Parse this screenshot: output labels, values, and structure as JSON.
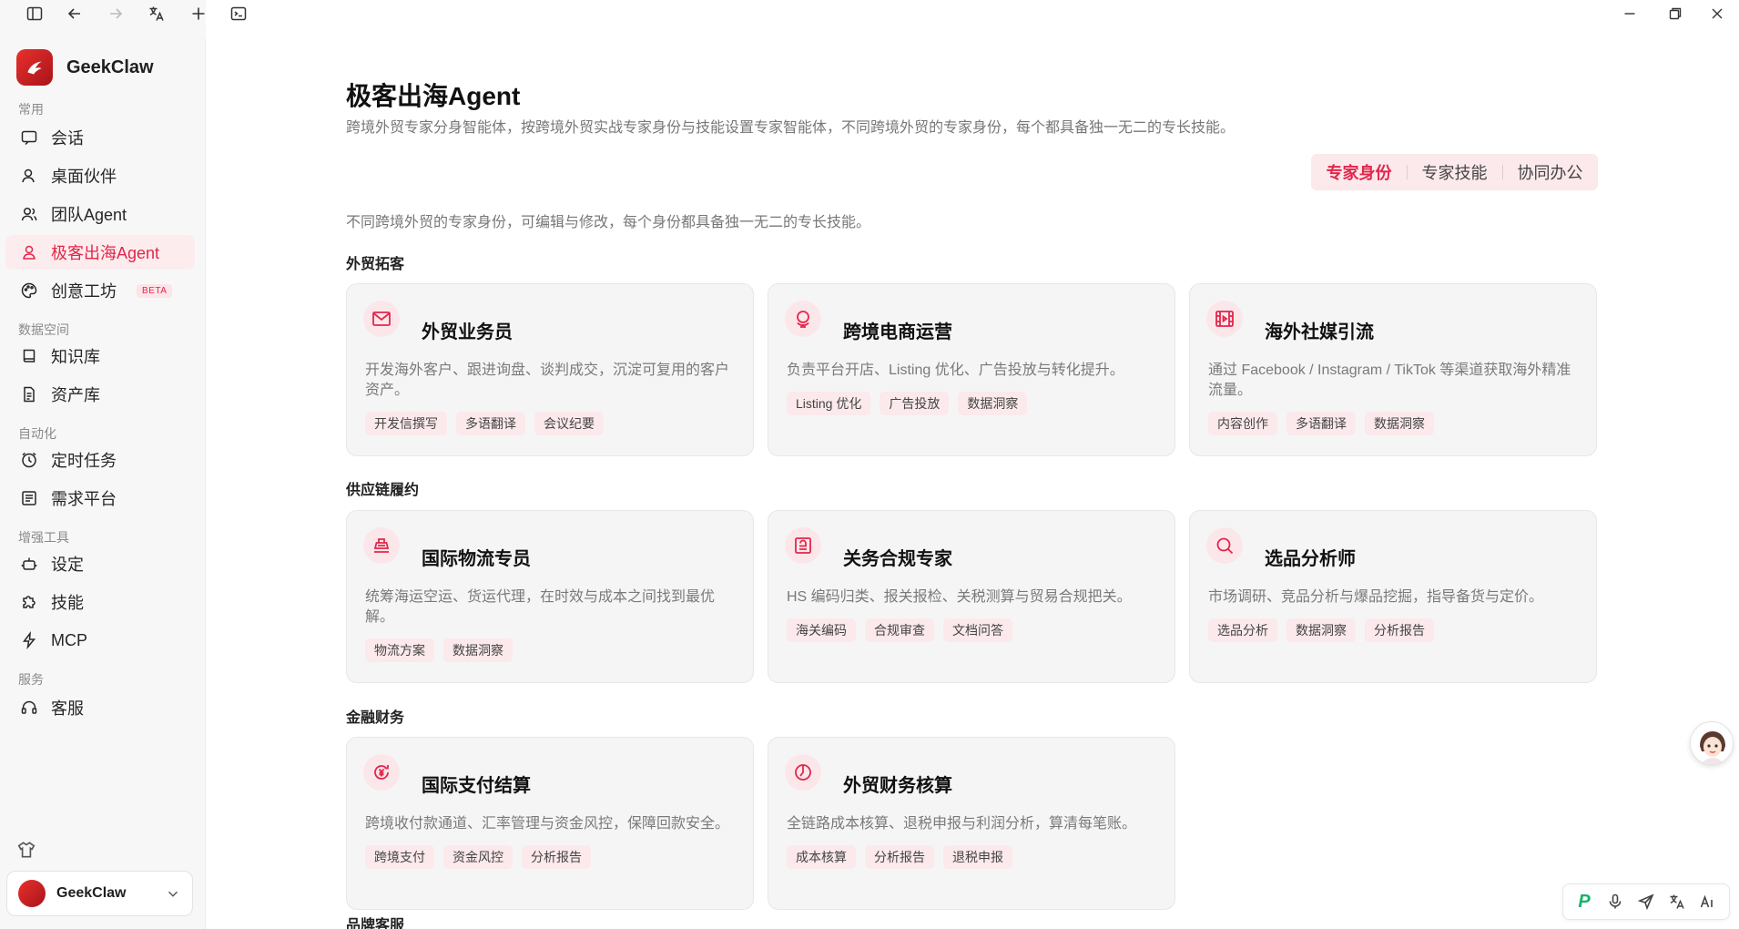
{
  "app": {
    "name": "GeekClaw",
    "account_name": "GeekClaw"
  },
  "sidebar": {
    "sections": [
      "常用",
      "数据空间",
      "自动化",
      "增强工具",
      "服务"
    ],
    "items": [
      {
        "label": "会话",
        "icon": "chat-icon"
      },
      {
        "label": "桌面伙伴",
        "icon": "user-icon"
      },
      {
        "label": "团队Agent",
        "icon": "team-icon"
      },
      {
        "label": "极客出海Agent",
        "icon": "user-icon",
        "active": true
      },
      {
        "label": "创意工坊",
        "icon": "palette-icon",
        "badge": "BETA"
      },
      {
        "label": "知识库",
        "icon": "book-icon"
      },
      {
        "label": "资产库",
        "icon": "document-icon"
      },
      {
        "label": "定时任务",
        "icon": "clock-icon"
      },
      {
        "label": "需求平台",
        "icon": "list-icon"
      },
      {
        "label": "设定",
        "icon": "robot-icon"
      },
      {
        "label": "技能",
        "icon": "puzzle-icon"
      },
      {
        "label": "MCP",
        "icon": "lightning-icon"
      },
      {
        "label": "客服",
        "icon": "headset-icon"
      }
    ]
  },
  "main": {
    "title": "极客出海Agent",
    "subtitle": "跨境外贸专家分身智能体，按跨境外贸实战专家身份与技能设置专家智能体，不同跨境外贸的专家身份，每个都具备独一无二的专长技能。",
    "tabs": [
      "专家身份",
      "专家技能",
      "协同办公"
    ],
    "active_tab": "专家身份",
    "description": "不同跨境外贸的专家身份，可编辑与修改，每个身份都具备独一无二的专长技能。",
    "groups": [
      {
        "title": "外贸拓客"
      },
      {
        "title": "供应链履约"
      },
      {
        "title": "金融财务"
      },
      {
        "title": "品牌客服"
      }
    ],
    "cards": [
      {
        "title": "外贸业务员",
        "desc": "开发海外客户、跟进询盘、谈判成交，沉淀可复用的客户资产。",
        "tags": [
          "开发信撰写",
          "多语翻译",
          "会议纪要"
        ],
        "icon": "mail-icon"
      },
      {
        "title": "跨境电商运营",
        "desc": "负责平台开店、Listing 优化、广告投放与转化提升。",
        "tags": [
          "Listing 优化",
          "广告投放",
          "数据洞察"
        ],
        "icon": "globe-icon"
      },
      {
        "title": "海外社媒引流",
        "desc": "通过 Facebook / Instagram / TikTok 等渠道获取海外精准流量。",
        "tags": [
          "内容创作",
          "多语翻译",
          "数据洞察"
        ],
        "icon": "video-icon"
      },
      {
        "title": "国际物流专员",
        "desc": "统筹海运空运、货运代理，在时效与成本之间找到最优解。",
        "tags": [
          "物流方案",
          "数据洞察"
        ],
        "icon": "ship-icon"
      },
      {
        "title": "关务合规专家",
        "desc": "HS 编码归类、报关报检、关税测算与贸易合规把关。",
        "tags": [
          "海关编码",
          "合规审查",
          "文档问答"
        ],
        "icon": "stamp-icon"
      },
      {
        "title": "选品分析师",
        "desc": "市场调研、竞品分析与爆品挖掘，指导备货与定价。",
        "tags": [
          "选品分析",
          "数据洞察",
          "分析报告"
        ],
        "icon": "search-icon"
      },
      {
        "title": "国际支付结算",
        "desc": "跨境收付款通道、汇率管理与资金风控，保障回款安全。",
        "tags": [
          "跨境支付",
          "资金风控",
          "分析报告"
        ],
        "icon": "yen-icon"
      },
      {
        "title": "外贸财务核算",
        "desc": "全链路成本核算、退税申报与利润分析，算清每笔账。",
        "tags": [
          "成本核算",
          "分析报告",
          "退税申报"
        ],
        "icon": "chart-pie-icon"
      }
    ]
  },
  "colors": {
    "accent": "#e2264b",
    "tag_bg": "#fbe9ec",
    "card_bg": "#f6f5f6",
    "sidebar_bg": "#f7f7f8"
  }
}
